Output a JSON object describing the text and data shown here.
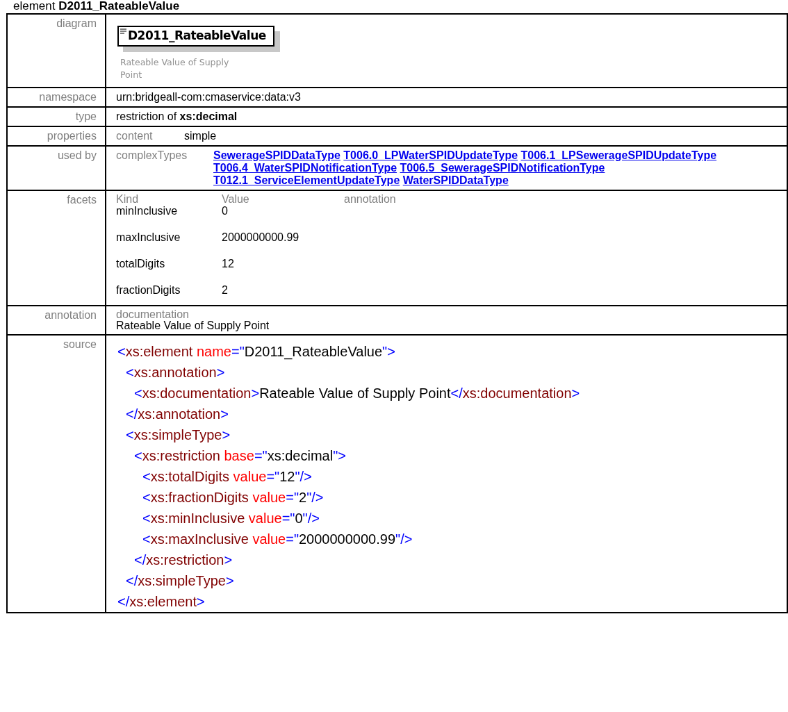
{
  "heading": "element **D2011_RateableValue**",
  "diagram": {
    "label": "diagram",
    "element_name": "D2011_RateableValue",
    "documentation": "Rateable Value of Supply Point"
  },
  "namespace": {
    "label": "namespace",
    "value": "urn:bridgeall-com:cmaservice:data:v3"
  },
  "type": {
    "label": "type",
    "value": "restriction of **xs:decimal**"
  },
  "properties": {
    "label": "properties",
    "items": [
      {
        "name": "content",
        "value": "simple"
      }
    ]
  },
  "used_by": {
    "label": "used by",
    "group": "complexTypes",
    "links": [
      {
        "text": "SewerageSPIDDataType"
      },
      {
        "text": "T006.0_LPWaterSPIDUpdateType"
      },
      {
        "text": "T006.1_LPSewerageSPIDUpdateType"
      },
      {
        "text": "T006.4_WaterSPIDNotificationType"
      },
      {
        "text": "T006.5_SewerageSPIDNotificationType"
      },
      {
        "text": "T012.1_ServiceElementUpdateType"
      },
      {
        "text": "WaterSPIDDataType"
      }
    ]
  },
  "facets": {
    "label": "facets",
    "columns": [
      "Kind",
      "Value",
      "annotation"
    ],
    "rows": [
      {
        "kind": "minInclusive",
        "value": "0"
      },
      {
        "kind": "maxInclusive",
        "value": "2000000000.99"
      },
      {
        "kind": "totalDigits",
        "value": "12"
      },
      {
        "kind": "fractionDigits",
        "value": "2"
      }
    ]
  },
  "annotation": {
    "label": "annotation",
    "heading": "documentation",
    "text": "Rateable Value of Supply Point"
  },
  "source": {
    "label": "source",
    "lines": [
      {
        "open": [
          {
            "kind": "punct",
            "text": "<"
          },
          {
            "kind": "tag",
            "text": "xs:element"
          },
          {
            "kind": "attr",
            "text": " name"
          },
          {
            "kind": "punct",
            "text": "=\""
          },
          {
            "kind": "value",
            "text": "D2011_RateableValue"
          },
          {
            "kind": "punct",
            "text": "\">"
          }
        ],
        "close": [
          {
            "kind": "punct",
            "text": "</"
          },
          {
            "kind": "tag",
            "text": "xs:element"
          },
          {
            "kind": "punct",
            "text": ">"
          }
        ],
        "children": [
          {
            "open": [
              {
                "kind": "punct",
                "text": "<"
              },
              {
                "kind": "tag",
                "text": "xs:annotation"
              },
              {
                "kind": "punct",
                "text": ">"
              }
            ],
            "close": [
              {
                "kind": "punct",
                "text": "</"
              },
              {
                "kind": "tag",
                "text": "xs:annotation"
              },
              {
                "kind": "punct",
                "text": ">"
              }
            ],
            "children": [
              {
                "open": [
                  {
                    "kind": "punct",
                    "text": "<"
                  },
                  {
                    "kind": "tag",
                    "text": "xs:documentation"
                  },
                  {
                    "kind": "punct",
                    "text": ">"
                  },
                  {
                    "kind": "value",
                    "text": "Rateable Value of Supply Point"
                  },
                  {
                    "kind": "punct",
                    "text": "</"
                  },
                  {
                    "kind": "tag",
                    "text": "xs:documentation"
                  },
                  {
                    "kind": "punct",
                    "text": ">"
                  }
                ]
              }
            ]
          },
          {
            "open": [
              {
                "kind": "punct",
                "text": "<"
              },
              {
                "kind": "tag",
                "text": "xs:simpleType"
              },
              {
                "kind": "punct",
                "text": ">"
              }
            ],
            "close": [
              {
                "kind": "punct",
                "text": "</"
              },
              {
                "kind": "tag",
                "text": "xs:simpleType"
              },
              {
                "kind": "punct",
                "text": ">"
              }
            ],
            "children": [
              {
                "open": [
                  {
                    "kind": "punct",
                    "text": "<"
                  },
                  {
                    "kind": "tag",
                    "text": "xs:restriction"
                  },
                  {
                    "kind": "attr",
                    "text": " base"
                  },
                  {
                    "kind": "punct",
                    "text": "=\""
                  },
                  {
                    "kind": "value",
                    "text": "xs:decimal"
                  },
                  {
                    "kind": "punct",
                    "text": "\">"
                  }
                ],
                "close": [
                  {
                    "kind": "punct",
                    "text": "</"
                  },
                  {
                    "kind": "tag",
                    "text": "xs:restriction"
                  },
                  {
                    "kind": "punct",
                    "text": ">"
                  }
                ],
                "children": [
                  {
                    "open": [
                      {
                        "kind": "punct",
                        "text": "<"
                      },
                      {
                        "kind": "tag",
                        "text": "xs:totalDigits"
                      },
                      {
                        "kind": "attr",
                        "text": " value"
                      },
                      {
                        "kind": "punct",
                        "text": "=\""
                      },
                      {
                        "kind": "value",
                        "text": "12"
                      },
                      {
                        "kind": "punct",
                        "text": "\"/>"
                      }
                    ]
                  },
                  {
                    "open": [
                      {
                        "kind": "punct",
                        "text": "<"
                      },
                      {
                        "kind": "tag",
                        "text": "xs:fractionDigits"
                      },
                      {
                        "kind": "attr",
                        "text": " value"
                      },
                      {
                        "kind": "punct",
                        "text": "=\""
                      },
                      {
                        "kind": "value",
                        "text": "2"
                      },
                      {
                        "kind": "punct",
                        "text": "\"/>"
                      }
                    ]
                  },
                  {
                    "open": [
                      {
                        "kind": "punct",
                        "text": "<"
                      },
                      {
                        "kind": "tag",
                        "text": "xs:minInclusive"
                      },
                      {
                        "kind": "attr",
                        "text": " value"
                      },
                      {
                        "kind": "punct",
                        "text": "=\""
                      },
                      {
                        "kind": "value",
                        "text": "0"
                      },
                      {
                        "kind": "punct",
                        "text": "\"/>"
                      }
                    ]
                  },
                  {
                    "open": [
                      {
                        "kind": "punct",
                        "text": "<"
                      },
                      {
                        "kind": "tag",
                        "text": "xs:maxInclusive"
                      },
                      {
                        "kind": "attr",
                        "text": " value"
                      },
                      {
                        "kind": "punct",
                        "text": "=\""
                      },
                      {
                        "kind": "value",
                        "text": "2000000000.99"
                      },
                      {
                        "kind": "punct",
                        "text": "\"/>"
                      }
                    ]
                  }
                ]
              }
            ]
          }
        ]
      }
    ]
  }
}
